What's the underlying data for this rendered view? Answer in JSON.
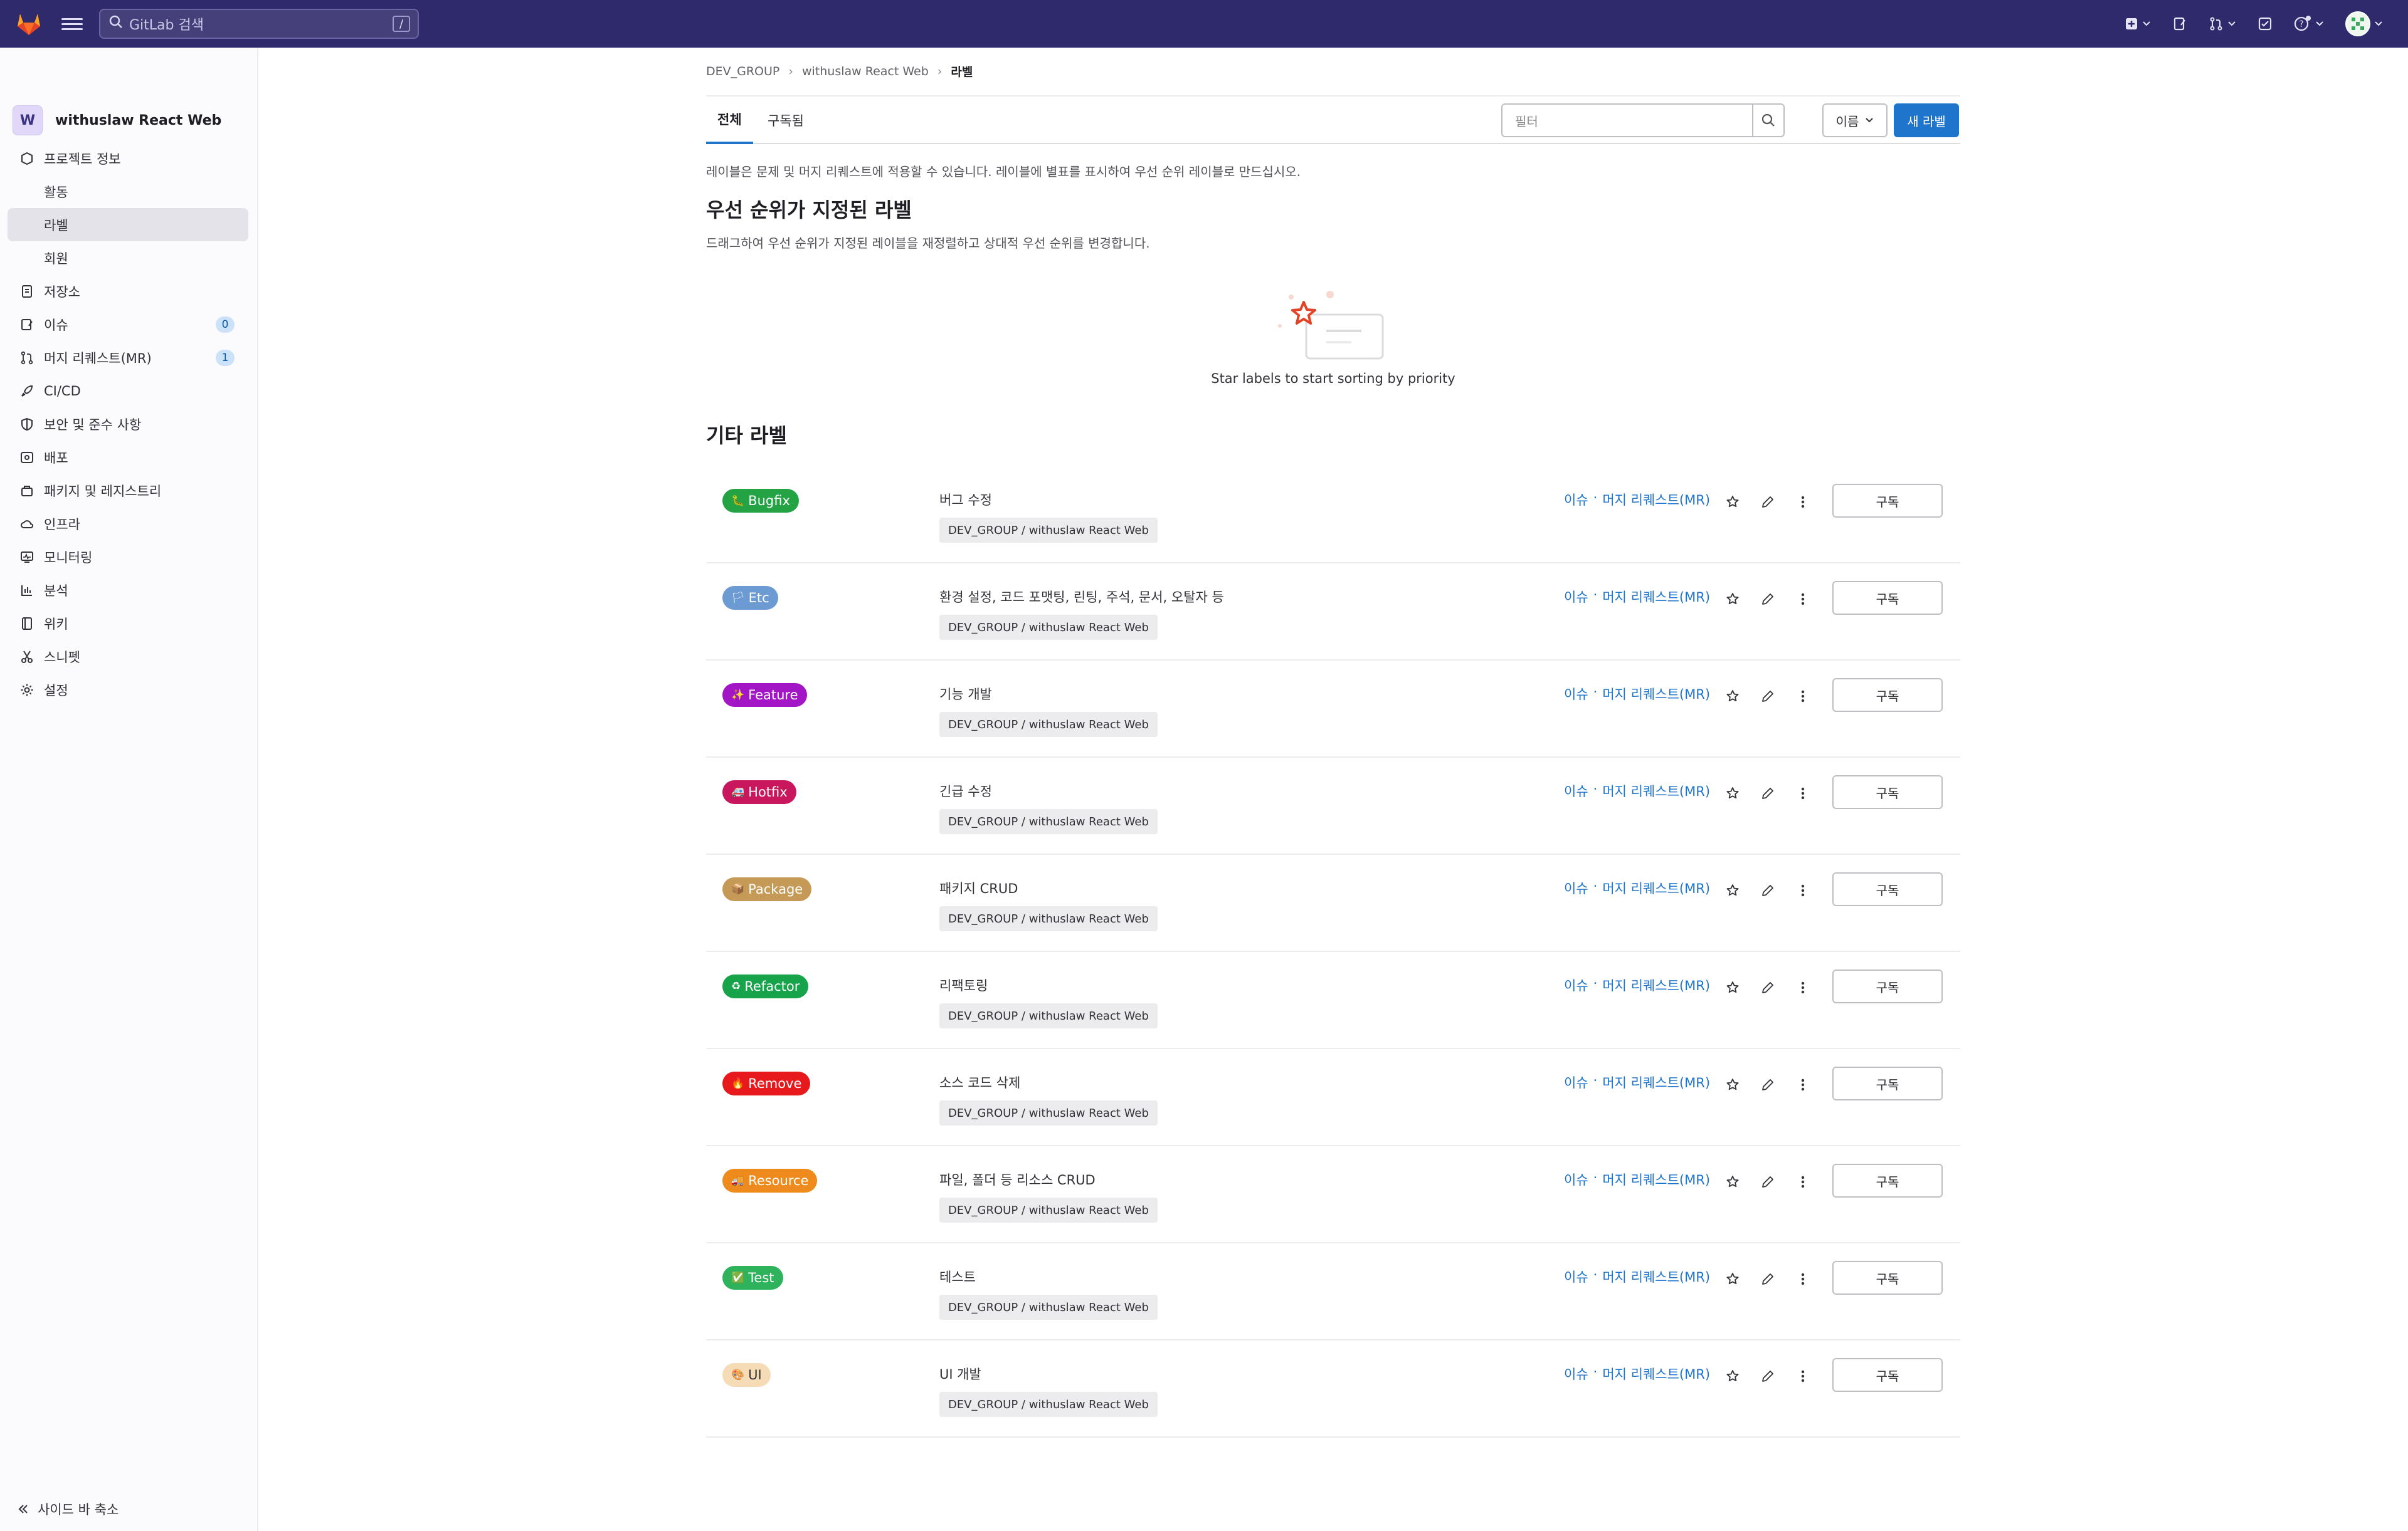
{
  "topbar": {
    "search_placeholder": "GitLab 검색",
    "search_shortcut": "/"
  },
  "sidebar": {
    "project_initial": "W",
    "project_name": "withuslaw React Web",
    "items": [
      {
        "label": "프로젝트 정보",
        "icon": "project-icon",
        "sub": false
      },
      {
        "label": "활동",
        "sub": true
      },
      {
        "label": "라벨",
        "sub": true,
        "active": true
      },
      {
        "label": "회원",
        "sub": true
      },
      {
        "label": "저장소",
        "icon": "repository-icon",
        "sub": false
      },
      {
        "label": "이슈",
        "icon": "issues-icon",
        "sub": false,
        "badge": "0"
      },
      {
        "label": "머지 리퀘스트(MR)",
        "icon": "merge-request-icon",
        "sub": false,
        "badge": "1"
      },
      {
        "label": "CI/CD",
        "icon": "rocket-icon",
        "sub": false
      },
      {
        "label": "보안 및 준수 사항",
        "icon": "shield-icon",
        "sub": false
      },
      {
        "label": "배포",
        "icon": "deployments-icon",
        "sub": false
      },
      {
        "label": "패키지 및 레지스트리",
        "icon": "package-icon",
        "sub": false
      },
      {
        "label": "인프라",
        "icon": "cloud-icon",
        "sub": false
      },
      {
        "label": "모니터링",
        "icon": "monitor-icon",
        "sub": false
      },
      {
        "label": "분석",
        "icon": "chart-icon",
        "sub": false
      },
      {
        "label": "위키",
        "icon": "book-icon",
        "sub": false
      },
      {
        "label": "스니펫",
        "icon": "scissors-icon",
        "sub": false
      },
      {
        "label": "설정",
        "icon": "settings-icon",
        "sub": false
      }
    ],
    "collapse_label": "사이드 바 축소"
  },
  "breadcrumb": {
    "group": "DEV_GROUP",
    "project": "withuslaw React Web",
    "current": "라벨"
  },
  "tabs": {
    "all": "전체",
    "subscribed": "구독됨"
  },
  "toolbar": {
    "filter_placeholder": "필터",
    "sort_label": "이름",
    "new_label": "새 라벨"
  },
  "intro": "레이블은 문제 및 머지 리퀘스트에 적용할 수 있습니다. 레이블에 별표를 표시하여 우선 순위 레이블로 만드십시오.",
  "prioritized": {
    "heading": "우선 순위가 지정된 라벨",
    "description": "드래그하여 우선 순위가 지정된 레이블을 재정렬하고 상대적 우선 순위를 변경합니다.",
    "empty_text": "Star labels to start sorting by priority"
  },
  "other": {
    "heading": "기타 라벨",
    "link_issues": "이슈",
    "link_separator": "·",
    "link_mrs": "머지 리퀘스트(MR)",
    "subscribe_label": "구독",
    "labels": [
      {
        "name": "Bugfix",
        "emoji": "🐛",
        "color": "#24a344",
        "text_color": "#ffffff",
        "description": "버그 수정",
        "path": "DEV_GROUP / withuslaw React Web"
      },
      {
        "name": "Etc",
        "emoji": "🏳",
        "color": "#6b9bd2",
        "text_color": "#ffffff",
        "description": "환경 설정, 코드 포맷팅, 린팅, 주석, 문서, 오탈자 등",
        "path": "DEV_GROUP / withuslaw React Web"
      },
      {
        "name": "Feature",
        "emoji": "✨",
        "color": "#a216c5",
        "text_color": "#ffffff",
        "description": "기능 개발",
        "path": "DEV_GROUP / withuslaw React Web"
      },
      {
        "name": "Hotfix",
        "emoji": "🚑",
        "color": "#c8175c",
        "text_color": "#ffffff",
        "description": "긴급 수정",
        "path": "DEV_GROUP / withuslaw React Web"
      },
      {
        "name": "Package",
        "emoji": "📦",
        "color": "#c59a56",
        "text_color": "#ffffff",
        "description": "패키지 CRUD",
        "path": "DEV_GROUP / withuslaw React Web"
      },
      {
        "name": "Refactor",
        "emoji": "♻",
        "color": "#16a34a",
        "text_color": "#ffffff",
        "description": "리팩토링",
        "path": "DEV_GROUP / withuslaw React Web"
      },
      {
        "name": "Remove",
        "emoji": "🔥",
        "color": "#e8191c",
        "text_color": "#ffffff",
        "description": "소스 코드 삭제",
        "path": "DEV_GROUP / withuslaw React Web"
      },
      {
        "name": "Resource",
        "emoji": "🚚",
        "color": "#ef8a1d",
        "text_color": "#ffffff",
        "description": "파일, 폴더 등 리소스 CRUD",
        "path": "DEV_GROUP / withuslaw React Web"
      },
      {
        "name": "Test",
        "emoji": "✅",
        "color": "#2eb35c",
        "text_color": "#ffffff",
        "description": "테스트",
        "path": "DEV_GROUP / withuslaw React Web"
      },
      {
        "name": "UI",
        "emoji": "🎨",
        "color": "#f6dcb6",
        "text_color": "#333238",
        "description": "UI 개발",
        "path": "DEV_GROUP / withuslaw React Web"
      }
    ]
  },
  "colors": {
    "topbar": "#2f2a6b",
    "accent": "#1f75cb"
  }
}
